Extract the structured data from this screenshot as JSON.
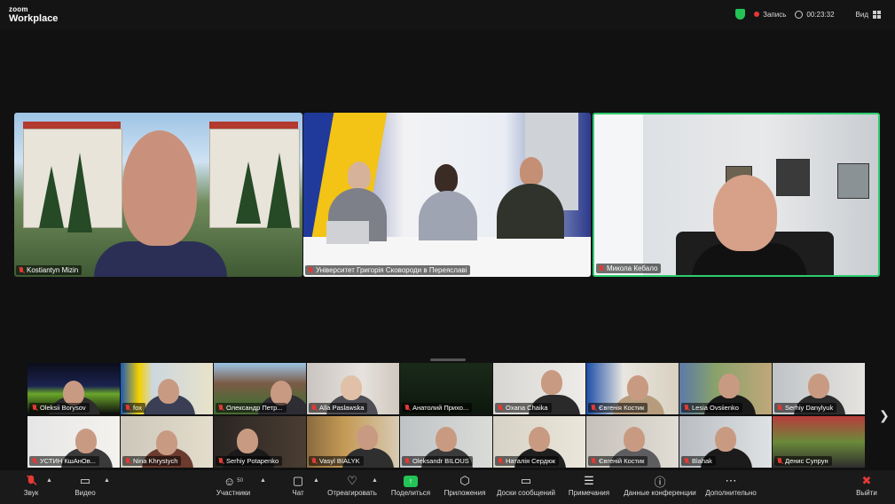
{
  "app": {
    "logo_line1": "zoom",
    "logo_line2": "Workplace"
  },
  "topbar": {
    "recording_label": "Запись",
    "timer": "00:23:32",
    "view_label": "Вид"
  },
  "speakers": [
    {
      "name": "Kostiantyn Mizin"
    },
    {
      "name": "Університет Григорія Сковороди в Переяславі"
    },
    {
      "name": "Микола Кебало"
    }
  ],
  "gallery": [
    {
      "name": "Oleksii Borysov"
    },
    {
      "name": "fox"
    },
    {
      "name": "Олександр Петр..."
    },
    {
      "name": "Alla Paslawska"
    },
    {
      "name": "Анатолий Прихо..."
    },
    {
      "name": "Oxana Chaika"
    },
    {
      "name": "Євгенія Костик"
    },
    {
      "name": "Lesia Ovsiienko"
    },
    {
      "name": "Serhiy Danylyuk"
    },
    {
      "name": "УСТИН КшАнОв..."
    },
    {
      "name": "Nina Khrystych"
    },
    {
      "name": "Serhiy Potapenko"
    },
    {
      "name": "Vasyl BIALYK"
    },
    {
      "name": "Oleksandr BILOUS"
    },
    {
      "name": "Наталія Сердюк"
    },
    {
      "name": "Євгеній Костик"
    },
    {
      "name": "Blahak"
    },
    {
      "name": "Денис Супрун"
    }
  ],
  "toolbar": {
    "audio": "Звук",
    "video": "Видео",
    "participants": "Участники",
    "participants_count": "50",
    "chat": "Чат",
    "react": "Отреагировать",
    "share": "Поделиться",
    "apps": "Приложения",
    "whiteboards": "Доски сообщений",
    "notes": "Примечания",
    "meeting_info": "Данные конференции",
    "more": "Дополнительно",
    "leave": "Выйти"
  },
  "colors": {
    "active_speaker_border": "#2ecc71",
    "muted_mic": "#e53935",
    "share": "#23c455",
    "leave": "#e53935"
  }
}
